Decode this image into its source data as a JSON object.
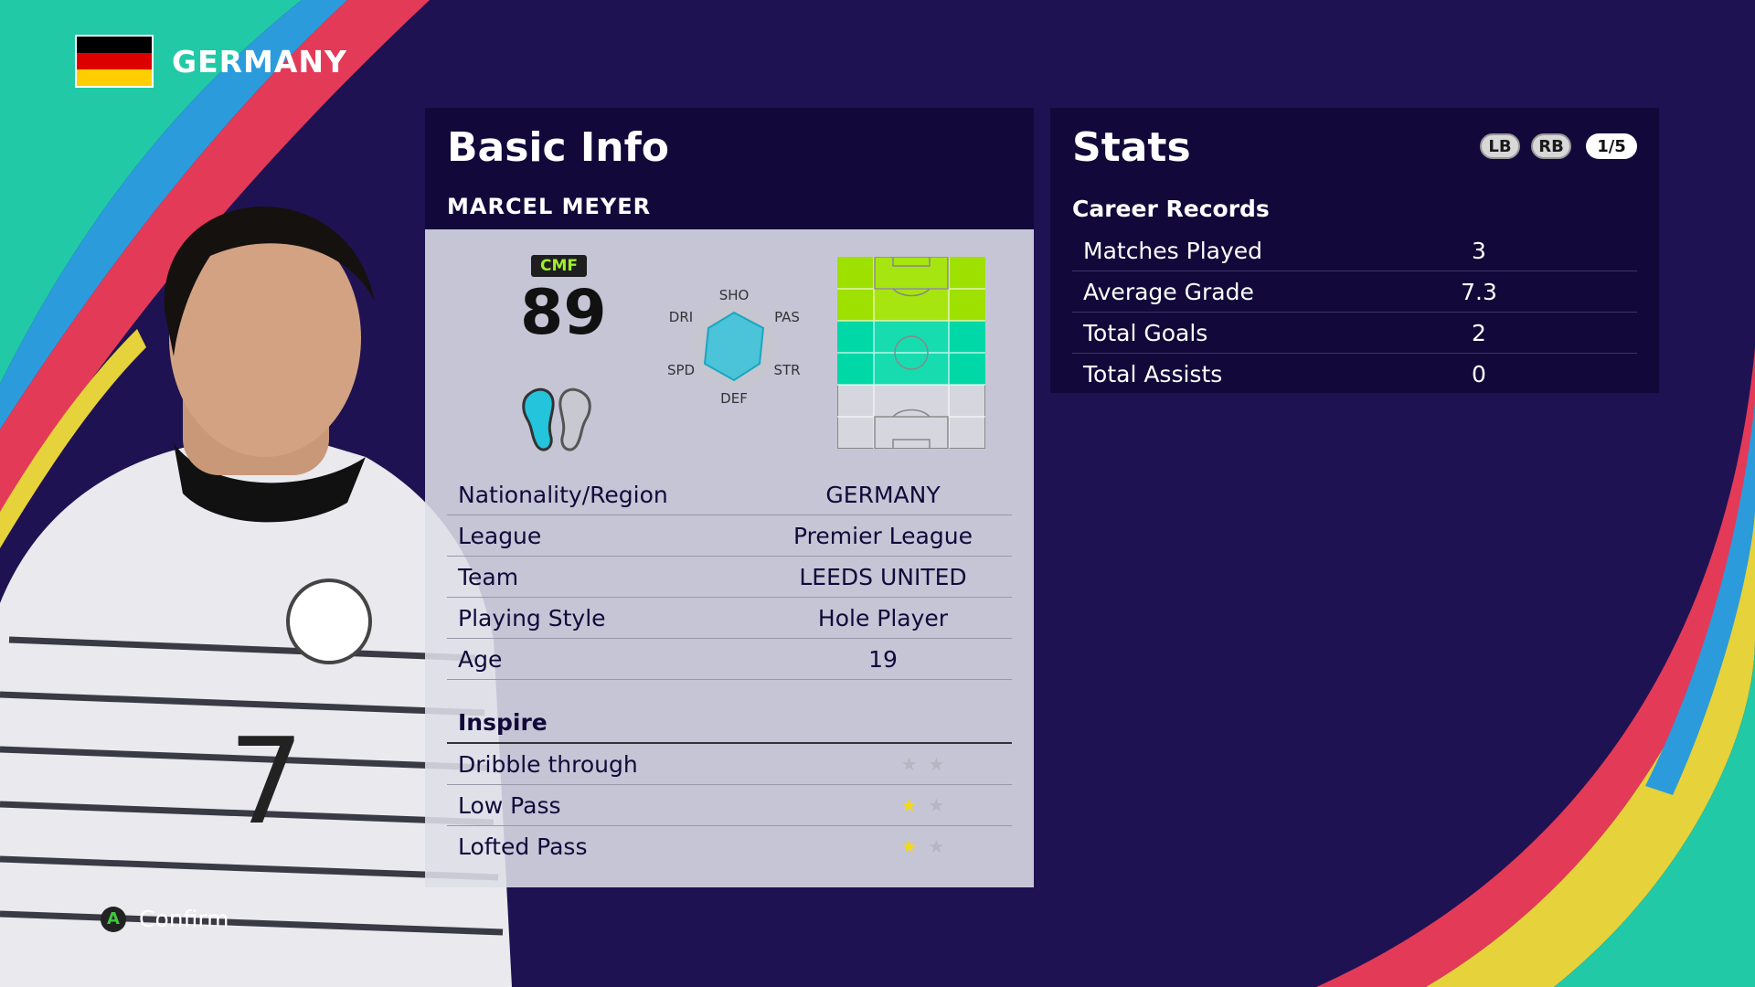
{
  "nation": {
    "name": "GERMANY",
    "flag_colors": [
      "#000000",
      "#dd0000",
      "#ffce00"
    ]
  },
  "footer": {
    "button": "A",
    "label": "Confirm"
  },
  "basic_info": {
    "title": "Basic Info",
    "player_name": "MARCEL MEYER",
    "position": "CMF",
    "rating": "89",
    "radar_labels": {
      "sho": "SHO",
      "pas": "PAS",
      "str": "STR",
      "def": "DEF",
      "spd": "SPD",
      "dri": "DRI"
    },
    "rows": [
      {
        "label": "Nationality/Region",
        "value": "GERMANY"
      },
      {
        "label": "League",
        "value": "Premier League"
      },
      {
        "label": "Team",
        "value": "LEEDS UNITED"
      },
      {
        "label": "Playing Style",
        "value": "Hole Player"
      },
      {
        "label": "Age",
        "value": "19"
      }
    ],
    "inspire": {
      "title": "Inspire",
      "rows": [
        {
          "label": "Dribble through",
          "stars_on": 0,
          "stars_total": 2
        },
        {
          "label": "Low Pass",
          "stars_on": 1,
          "stars_total": 2
        },
        {
          "label": "Lofted Pass",
          "stars_on": 1,
          "stars_total": 2
        }
      ]
    }
  },
  "stats": {
    "title": "Stats",
    "buttons": {
      "lb": "LB",
      "rb": "RB",
      "page": "1/5"
    },
    "career_title": "Career Records",
    "rows": [
      {
        "label": "Matches Played",
        "value": "3"
      },
      {
        "label": "Average Grade",
        "value": "7.3"
      },
      {
        "label": "Total Goals",
        "value": "2"
      },
      {
        "label": "Total Assists",
        "value": "0"
      }
    ]
  },
  "colors": {
    "background": "#1f1252",
    "panel_dark": "#12093a",
    "position_primary": "#9ee000",
    "position_secondary": "#00d8a8",
    "radar_fill": "#4bc3d8"
  }
}
